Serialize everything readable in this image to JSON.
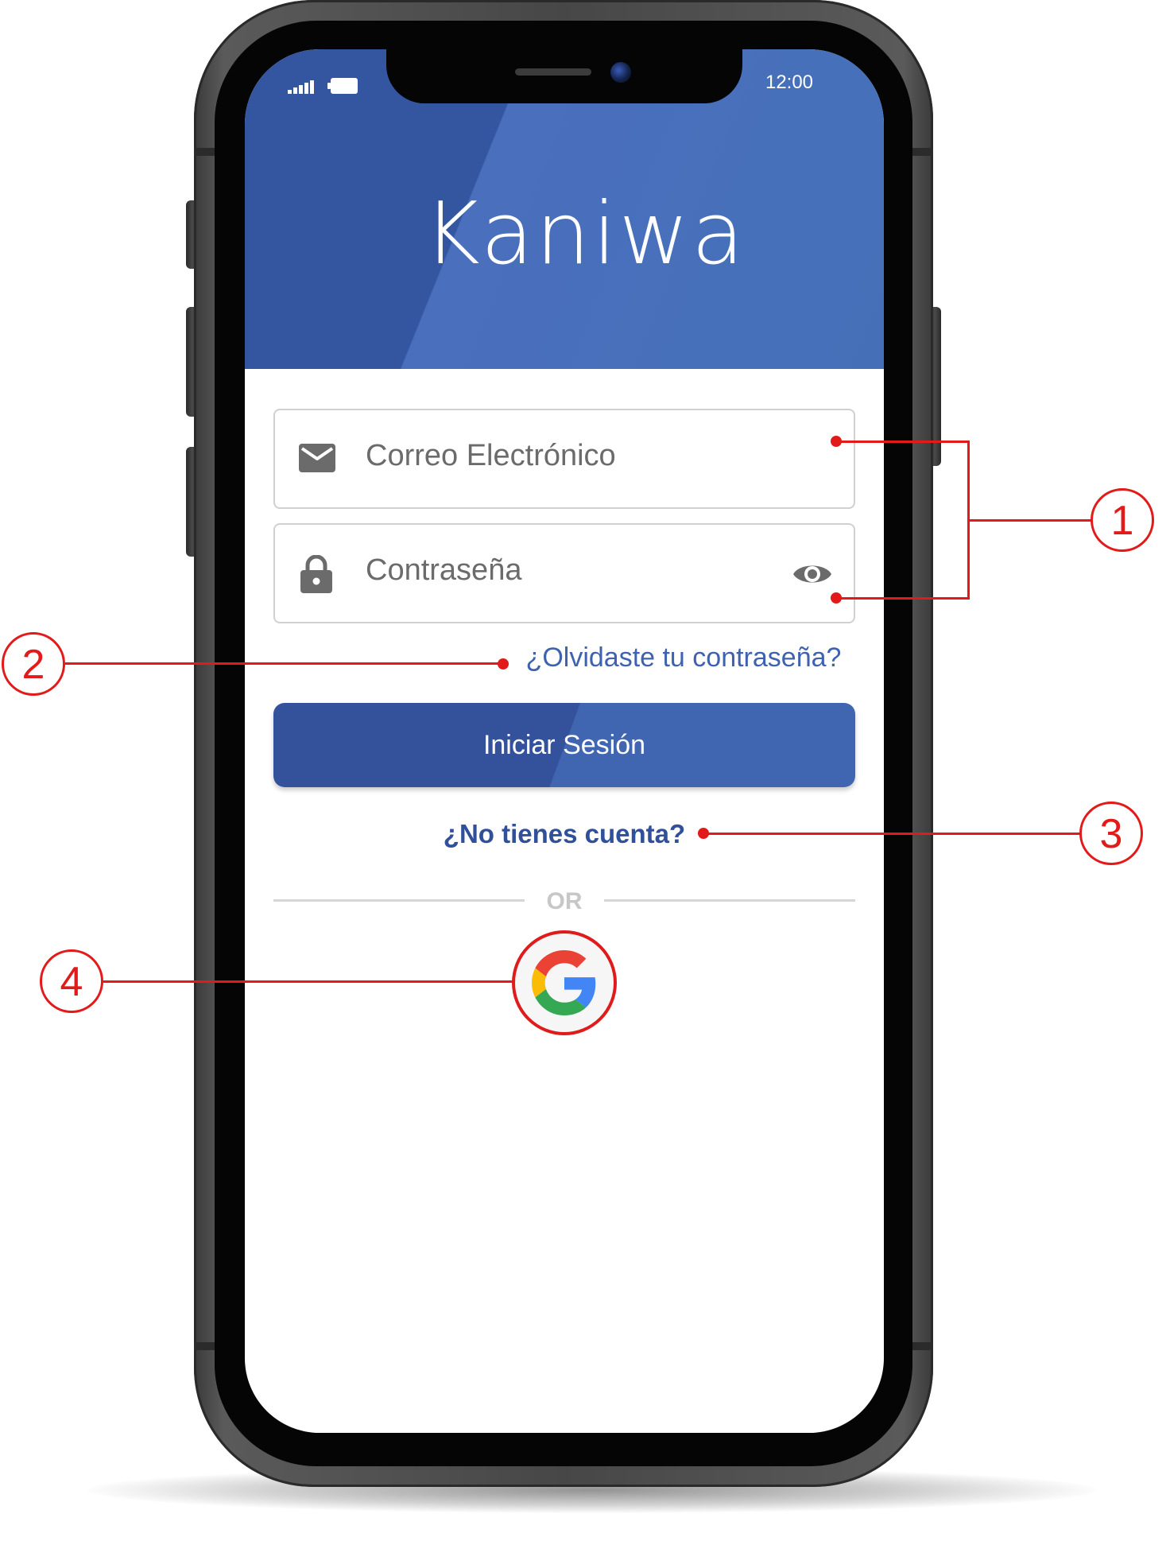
{
  "status_bar": {
    "time": "12:00",
    "signal_icon": "signal-bars-icon",
    "battery_icon": "battery-icon"
  },
  "header": {
    "brand": "Kaniwa",
    "background_color": "#4570b8"
  },
  "form": {
    "email": {
      "placeholder": "Correo Electrónico",
      "icon": "mail-icon"
    },
    "password": {
      "placeholder": "Contraseña",
      "icon": "lock-icon",
      "toggle_icon": "eye-icon"
    },
    "forgot_link": "¿Olvidaste tu contraseña?",
    "login_button": "Iniciar Sesión",
    "signup_link": "¿No tienes cuenta?",
    "divider_text": "OR",
    "google_button_icon": "google-g-icon"
  },
  "annotations": {
    "callout_1": "1",
    "callout_2": "2",
    "callout_3": "3",
    "callout_4": "4",
    "color": "#e21a1a"
  },
  "colors": {
    "primary": "#34529c",
    "link": "#3f62b0",
    "placeholder": "#6b6b6b"
  }
}
